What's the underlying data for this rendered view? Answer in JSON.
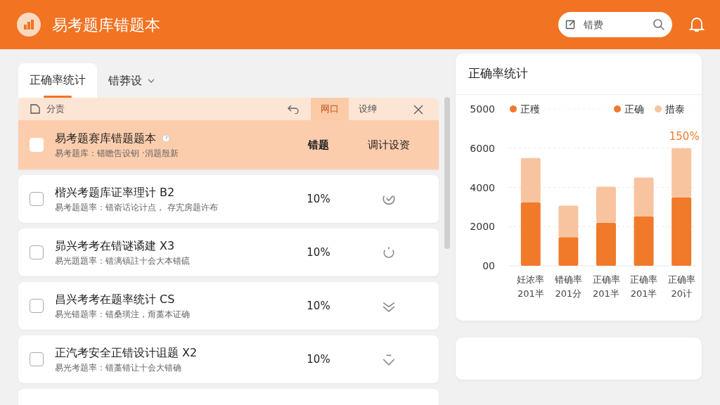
{
  "header": {
    "title": "易考题库错题本",
    "search": {
      "placeholder": "错费"
    }
  },
  "tabs": [
    {
      "label": "正确率统计",
      "selected": true
    },
    {
      "label": "错莽设",
      "selected": false,
      "dropdown": true
    }
  ],
  "list": {
    "toolbar": {
      "label": "分责",
      "buttons": [
        {
          "label": "网口",
          "selected": true
        },
        {
          "label": "设绅",
          "selected": false
        }
      ]
    },
    "rows": [
      {
        "title": "易考题赛库错题题本",
        "subtitle": "易考题库：错瞻告设钥 ·涓题殷新",
        "column_2": "错题",
        "column_3": "调计设资",
        "selected": true,
        "checked": false,
        "kind": "header"
      },
      {
        "title": "楷兴考题库证率理计 B2",
        "subtitle": "易考题题率：错嵛话论计点， 存宄房题许布",
        "column_2": "10%",
        "selected": false,
        "checked": false,
        "kind": "item"
      },
      {
        "title": "昴兴考考在错谜谲建 X3",
        "subtitle": "易光題題率：错漓镇註十会大本错硫",
        "column_2": "10%",
        "selected": false,
        "checked": false,
        "kind": "item"
      },
      {
        "title": "昌兴考考在题率统计 CS",
        "subtitle": "易光错题率：错桑璜注，甭藁本证确",
        "column_2": "10%",
        "selected": false,
        "checked": false,
        "kind": "item"
      },
      {
        "title": "正汽考安全正错设计诅题 X2",
        "subtitle": "易光考题率：错藁错让十会大错确",
        "column_2": "10%",
        "selected": false,
        "checked": false,
        "kind": "item"
      }
    ]
  },
  "stats_card": {
    "title": "正确率统计",
    "extra_legend": {
      "label": "正穫",
      "color": "#f07a2a"
    },
    "chart_data": {
      "type": "bar",
      "stacked": true,
      "categories": [
        "妊浓率\n201半",
        "错确率\n201分",
        "正确率\n201半",
        "正确率\n201半",
        "正确率\n20计"
      ],
      "series": [
        {
          "name": "正确",
          "color": "#f07a2a",
          "values": [
            3250,
            1460,
            2200,
            2530,
            3500
          ]
        },
        {
          "name": "措泰",
          "color": "#f8c4a0",
          "values": [
            2250,
            1610,
            1840,
            1970,
            2500
          ]
        }
      ],
      "ylim": [
        0,
        8000
      ],
      "ylabel": "5000",
      "yticks": [
        {
          "value": 0,
          "label": "00"
        },
        2000,
        4000,
        6000
      ],
      "grid": true,
      "legend": "top",
      "annotations": [
        {
          "x": "正确率\n20计",
          "y": 6000,
          "text": "150%"
        }
      ]
    }
  }
}
